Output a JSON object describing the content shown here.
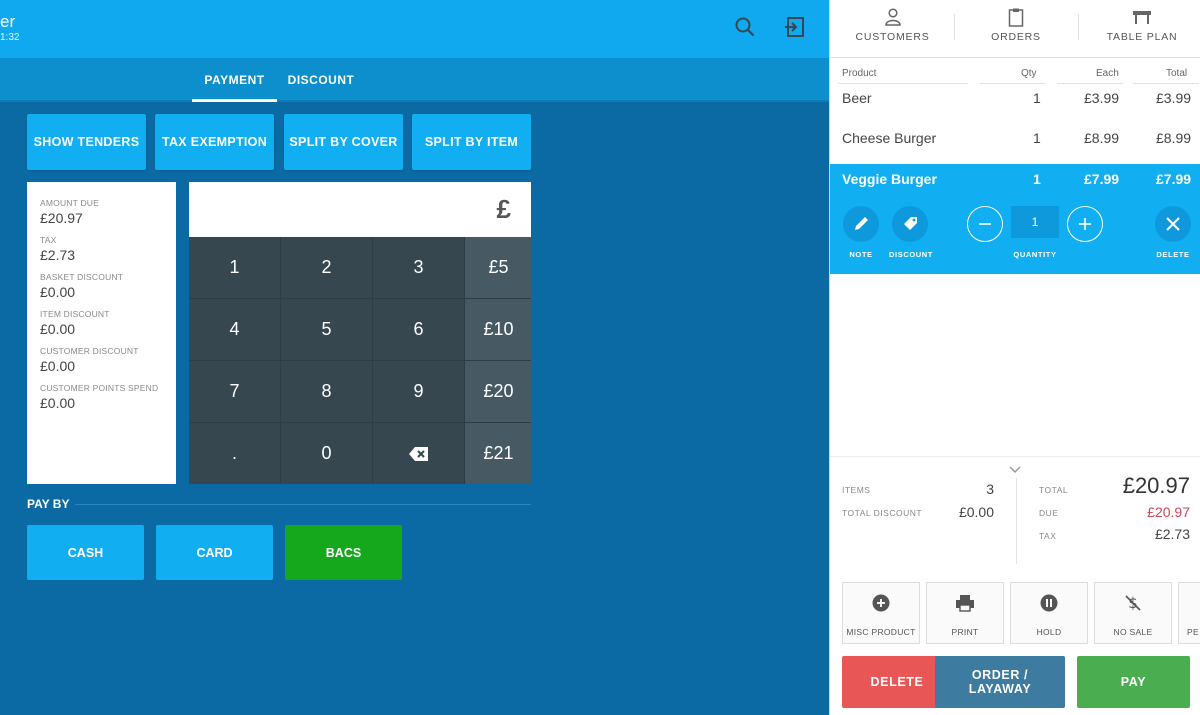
{
  "header": {
    "title": "er",
    "subtitle": "1:32"
  },
  "tabs": [
    {
      "label": "PAYMENT",
      "active": true
    },
    {
      "label": "DISCOUNT",
      "active": false
    }
  ],
  "actions": {
    "show_tenders": "SHOW TENDERS",
    "tax_exemption": "TAX EXEMPTION",
    "split_by_cover": "SPLIT BY COVER",
    "split_by_item": "SPLIT BY ITEM"
  },
  "summary": {
    "amount_due_label": "AMOUNT DUE",
    "amount_due": "£20.97",
    "tax_label": "TAX",
    "tax": "£2.73",
    "basket_discount_label": "BASKET DISCOUNT",
    "basket_discount": "£0.00",
    "item_discount_label": "ITEM DISCOUNT",
    "item_discount": "£0.00",
    "customer_discount_label": "CUSTOMER DISCOUNT",
    "customer_discount": "£0.00",
    "customer_points_label": "CUSTOMER POINTS SPEND",
    "customer_points": "£0.00"
  },
  "entry": {
    "currency": "£"
  },
  "keypad": {
    "k1": "1",
    "k2": "2",
    "k3": "3",
    "m5": "£5",
    "k4": "4",
    "k5": "5",
    "k6": "6",
    "m10": "£10",
    "k7": "7",
    "k8": "8",
    "k9": "9",
    "m20": "£20",
    "kdot": ".",
    "k0": "0",
    "m21": "£21"
  },
  "pay_by": {
    "label": "PAY BY",
    "cash": "CASH",
    "card": "CARD",
    "bacs": "BACS"
  },
  "right_tabs": {
    "customers": "CUSTOMERS",
    "orders": "ORDERS",
    "table_plan": "TABLE PLAN"
  },
  "order_table": {
    "headers": {
      "product": "Product",
      "qty": "Qty",
      "each": "Each",
      "total": "Total"
    },
    "rows": [
      {
        "product": "Beer",
        "qty": "1",
        "each": "£3.99",
        "total": "£3.99"
      },
      {
        "product": "Cheese Burger",
        "qty": "1",
        "each": "£8.99",
        "total": "£8.99"
      },
      {
        "product": "Veggie Burger",
        "qty": "1",
        "each": "£7.99",
        "total": "£7.99"
      }
    ]
  },
  "item_edit": {
    "note": "NOTE",
    "discount": "DISCOUNT",
    "quantity_label": "QUANTITY",
    "quantity": "1",
    "delete": "DELETE"
  },
  "totals": {
    "items_label": "ITEMS",
    "items": "3",
    "total_discount_label": "TOTAL DISCOUNT",
    "total_discount": "£0.00",
    "total_label": "TOTAL",
    "total": "£20.97",
    "due_label": "DUE",
    "due": "£20.97",
    "tax_label": "TAX",
    "tax": "£2.73"
  },
  "quick_actions": {
    "misc_product": "MISC PRODUCT",
    "print": "PRINT",
    "hold": "HOLD",
    "no_sale": "NO SALE",
    "cut": "PE"
  },
  "bottom": {
    "delete": "DELETE",
    "order_layaway": "ORDER / LAYAWAY",
    "pay": "PAY"
  },
  "colors": {
    "accent": "#12aef2",
    "header": "#10a8ee",
    "background": "#0b6aa4",
    "bacs": "#15a81c",
    "delete": "#e85656",
    "order": "#3d7ba0",
    "pay": "#4aae50",
    "due": "#c9475a"
  }
}
